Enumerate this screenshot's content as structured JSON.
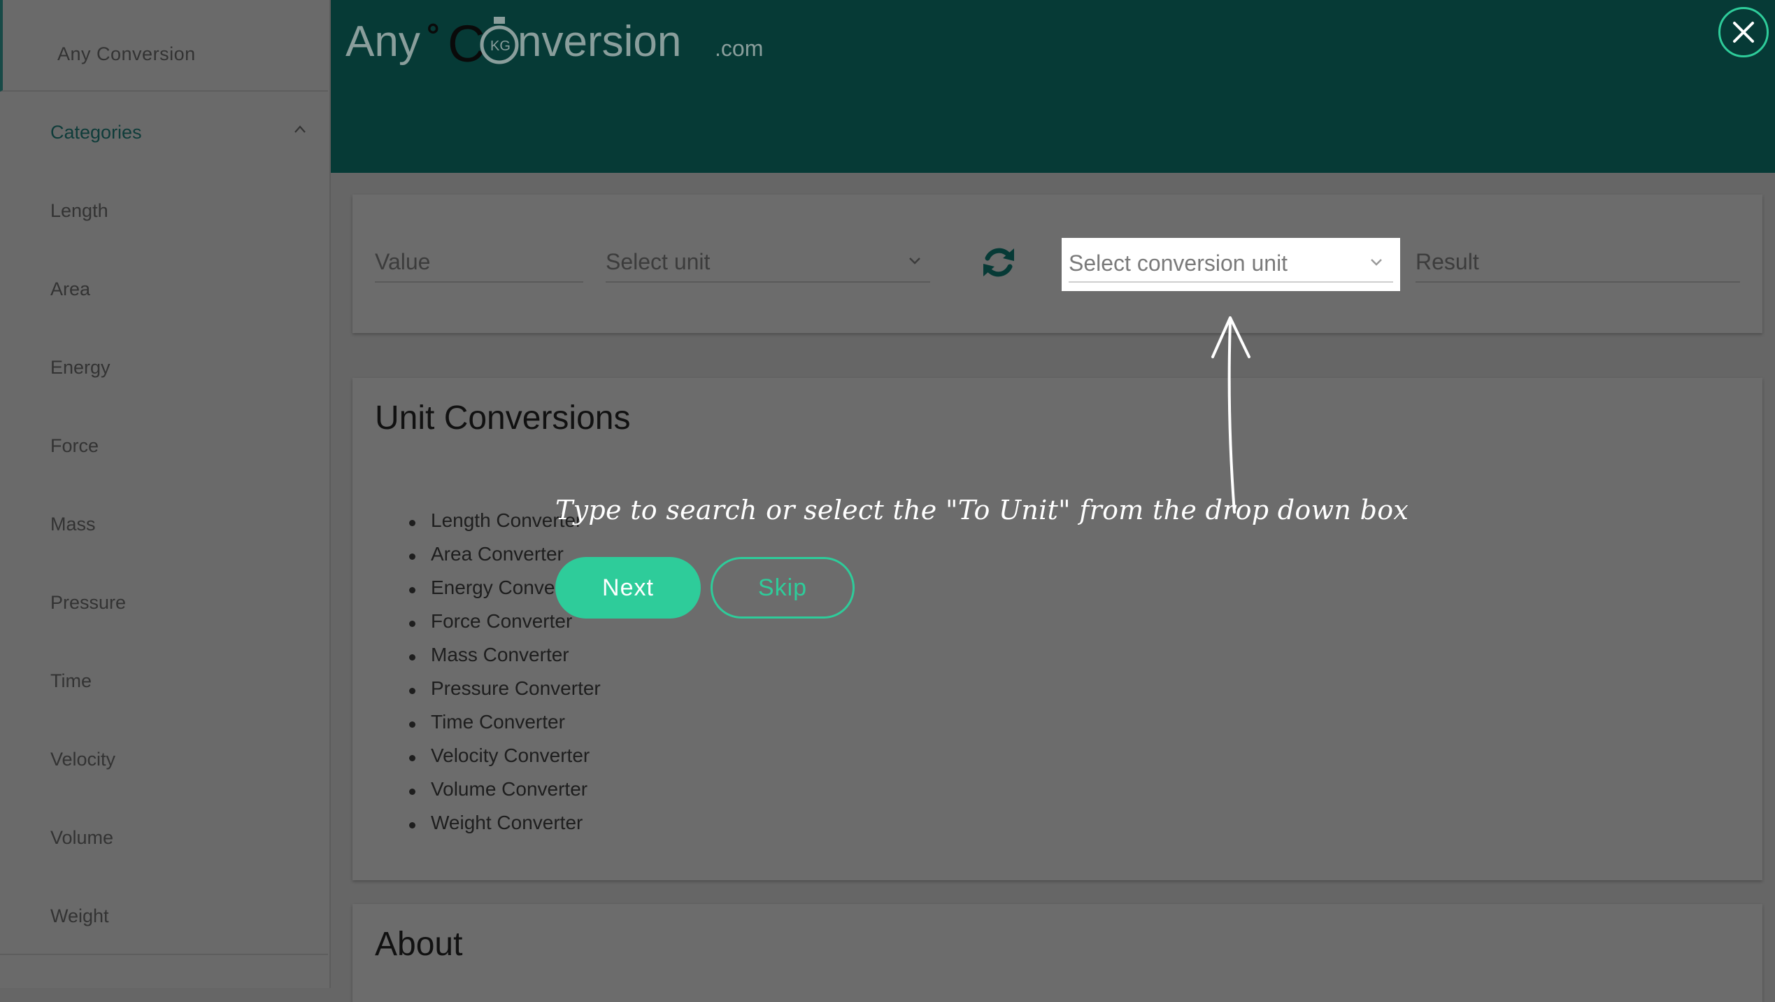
{
  "sidebar": {
    "brand": "Any Conversion",
    "categories_label": "Categories",
    "items": [
      {
        "label": "Length"
      },
      {
        "label": "Area"
      },
      {
        "label": "Energy"
      },
      {
        "label": "Force"
      },
      {
        "label": "Mass"
      },
      {
        "label": "Pressure"
      },
      {
        "label": "Time"
      },
      {
        "label": "Velocity"
      },
      {
        "label": "Volume"
      },
      {
        "label": "Weight"
      }
    ]
  },
  "header": {
    "logo": {
      "part1": "Any",
      "degree": "°",
      "c": "C",
      "kg": "KG",
      "part2": "nversion",
      "tld": ".com"
    }
  },
  "converter": {
    "value_placeholder": "Value",
    "from_unit_placeholder": "Select unit",
    "to_unit_placeholder": "Select conversion unit",
    "result_placeholder": "Result"
  },
  "unit_conversions": {
    "title": "Unit Conversions",
    "items": [
      "Length Converter",
      "Area Converter",
      "Energy Converter",
      "Force Converter",
      "Mass Converter",
      "Pressure Converter",
      "Time Converter",
      "Velocity Converter",
      "Volume Converter",
      "Weight Converter"
    ]
  },
  "about": {
    "title": "About"
  },
  "tour": {
    "tip": "Type to search or select the \"To Unit\" from the drop down box",
    "next_label": "Next",
    "skip_label": "Skip"
  },
  "colors": {
    "header_bg": "#063a36",
    "accent": "#2ecc9a",
    "overlay_gray": "#666666"
  }
}
